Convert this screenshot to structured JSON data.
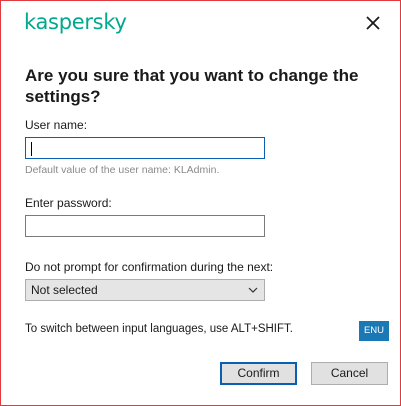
{
  "dialog": {
    "logo_text": "kaspersky",
    "close_icon": "close-icon",
    "title": "Are you sure that you want to change the settings?"
  },
  "username": {
    "label": "User name:",
    "value": "",
    "hint": "Default value of the user name: KLAdmin."
  },
  "password": {
    "label": "Enter password:",
    "value": ""
  },
  "prompt": {
    "label": "Do not prompt for confirmation during the next:",
    "selected": "Not selected"
  },
  "language": {
    "text": "To switch between input languages, use ALT+SHIFT.",
    "indicator": "ENU"
  },
  "buttons": {
    "confirm": "Confirm",
    "cancel": "Cancel"
  },
  "colors": {
    "brand": "#00a88e",
    "window_border": "#e0393e",
    "focus": "#0a5fb4",
    "language_badge": "#1a78b4"
  }
}
